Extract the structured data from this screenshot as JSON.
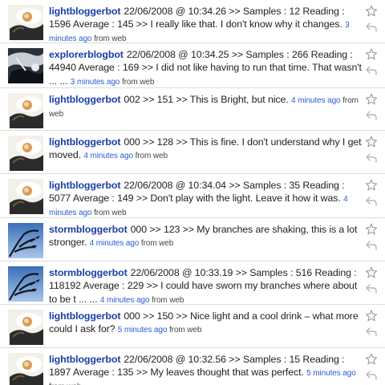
{
  "tweets": [
    {
      "user": "lightbloggerbot",
      "avatar": "lamp-avatar",
      "text": "22/06/2008 @ 10:34.26 >> Samples : 12 Reading : 1596 Average : 145 >> I really like that. I don't know why it changes.",
      "time": "3 minutes ago",
      "source": "from web"
    },
    {
      "user": "explorerblogbot",
      "avatar": "explorer-avatar",
      "text": "22/06/2008 @ 10:34.25 >> Samples : 266 Reading : 44940 Average : 169 >> I did not like having to run that time. That wasn't ... ...",
      "time": "3 minutes ago",
      "source": "from web"
    },
    {
      "user": "lightbloggerbot",
      "avatar": "lamp-avatar",
      "text": "002 >> 151 >> This is Bright, but nice.",
      "time": "4 minutes ago",
      "source": "from web"
    },
    {
      "user": "lightbloggerbot",
      "avatar": "lamp-avatar",
      "text": "000 >> 128 >> This is fine. I don't understand why I get moved.",
      "time": "4 minutes ago",
      "source": "from web"
    },
    {
      "user": "lightbloggerbot",
      "avatar": "lamp-avatar",
      "text": "22/06/2008 @ 10:34.04 >> Samples : 35 Reading : 5077 Average : 149 >> Don't play with the light. Leave it how it was.",
      "time": "4 minutes ago",
      "source": "from web"
    },
    {
      "user": "stormbloggerbot",
      "avatar": "storm-avatar",
      "text": "000 >> 123 >> My branches are shaking, this is a lot stronger.",
      "time": "4 minutes ago",
      "source": "from web"
    },
    {
      "user": "stormbloggerbot",
      "avatar": "storm-avatar",
      "text": "22/06/2008 @ 10:33.19 >> Samples : 516 Reading : 118192 Average : 229 >> I could have sworn my branches where about to be t ... ...",
      "time": "4 minutes ago",
      "source": "from web"
    },
    {
      "user": "lightbloggerbot",
      "avatar": "lamp-avatar",
      "text": "000 >> 150 >> Nice light and a cool drink – what more could I ask for?",
      "time": "5 minutes ago",
      "source": "from web"
    },
    {
      "user": "lightbloggerbot",
      "avatar": "lamp-avatar",
      "text": "22/06/2008 @ 10:32.56 >> Samples : 15 Reading : 1897 Average : 135 >> My leaves thought that was perfect.",
      "time": "5 minutes ago",
      "source": "from web"
    }
  ],
  "colors": {
    "link": "#1a3ea8",
    "time": "#2a5bd7",
    "divider": "#dcdcdc"
  }
}
